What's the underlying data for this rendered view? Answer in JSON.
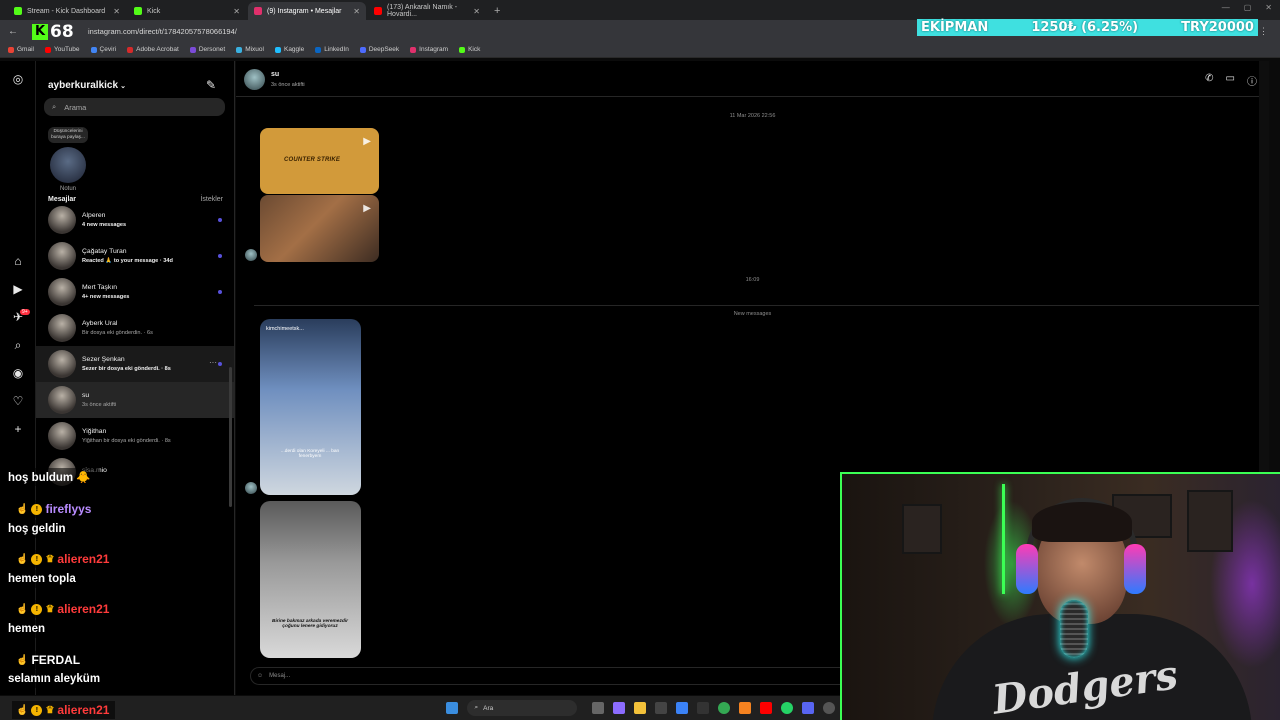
{
  "browser": {
    "tabs": [
      {
        "label": "Stream - Kick Dashboard",
        "color": "#53fc18",
        "active": false
      },
      {
        "label": "Kick",
        "color": "#53fc18",
        "active": false
      },
      {
        "label": "(9) Instagram • Mesajlar",
        "color": "#e1306c",
        "active": true
      },
      {
        "label": "(173) Ankaralı Namık - Hovardi...",
        "color": "#ff0000",
        "active": false
      }
    ],
    "url": "instagram.com/direct/t/17842057578066194/",
    "bookmarks": [
      {
        "label": "Gmail",
        "color": "#ea4335"
      },
      {
        "label": "YouTube",
        "color": "#ff0000"
      },
      {
        "label": "Çeviri",
        "color": "#4285f4"
      },
      {
        "label": "Adobe Acrobat",
        "color": "#d62a2a"
      },
      {
        "label": "Dersonet",
        "color": "#7b4bd8"
      },
      {
        "label": "Mixuol",
        "color": "#3ab0e0"
      },
      {
        "label": "Kaggle",
        "color": "#20beff"
      },
      {
        "label": "LinkedIn",
        "color": "#0a66c2"
      },
      {
        "label": "DeepSeek",
        "color": "#4d6bfe"
      },
      {
        "label": "Instagram",
        "color": "#e1306c"
      },
      {
        "label": "Kick",
        "color": "#53fc18"
      }
    ]
  },
  "kick_overlay": {
    "logo_letter": "K",
    "viewer_count": "68"
  },
  "ticker": {
    "label": "EKİPMAN",
    "progress": "1250₺ (6.25%)",
    "goal": "TRY20000",
    "color": "#3fe0e0"
  },
  "inbox": {
    "username": "ayberkuralkick",
    "search_placeholder": "Arama",
    "note": {
      "bubble": "Düşüncelerini buraya paylaş...",
      "label": "Notun"
    },
    "section_title": "Mesajlar",
    "requests_label": "İstekler",
    "threads": [
      {
        "name": "Alperen",
        "sub": "4 new messages",
        "bold": true,
        "unread": true
      },
      {
        "name": "Çağatay Turan",
        "sub": "Reacted 🙏 to your message · 34d",
        "bold": true,
        "unread": true
      },
      {
        "name": "Mert Taşkın",
        "sub": "4+ new messages",
        "bold": true,
        "unread": true
      },
      {
        "name": "Ayberk Ural",
        "sub": "Bir dosya eki gönderdin. · 6s",
        "bold": false,
        "unread": false
      },
      {
        "name": "Sezer Şenkan",
        "sub": "Sezer bir dosya eki gönderdi. · 8s",
        "bold": true,
        "unread": true
      },
      {
        "name": "su",
        "sub": "3s önce aktifti",
        "bold": false,
        "unread": false
      },
      {
        "name": "Yiğithan",
        "sub": "Yiğithan bir dosya eki gönderdi. · 8s",
        "bold": false,
        "unread": false
      },
      {
        "name": "sisa.mio",
        "sub": "",
        "bold": false,
        "unread": false
      }
    ]
  },
  "chat": {
    "name": "su",
    "status": "3s önce aktifti",
    "date1": "11 Mar 2026 22:56",
    "date2": "16:09",
    "new_messages": "New messages",
    "cs_title": "COUNTER STRIKE",
    "reel1_header": "kimchimeetsk...",
    "reel1_caption": "...derdi olan Koreyeli ... ban fenerbyem",
    "reel2_caption": "Birine bakmaz arkada veremezdir çoğunu lenere gidiyoruz",
    "composer_placeholder": "Mesaj..."
  },
  "stream_chat": [
    {
      "type": "text",
      "text": "hoş buldum 🐥"
    },
    {
      "type": "user",
      "name": "fireflyys",
      "color": "#b98cff"
    },
    {
      "type": "text",
      "text": "hoş geldin"
    },
    {
      "type": "user",
      "name": "alieren21",
      "color": "#ff3b3b"
    },
    {
      "type": "text",
      "text": "hemen topla"
    },
    {
      "type": "user",
      "name": "alieren21",
      "color": "#ff3b3b"
    },
    {
      "type": "text",
      "text": "hemen"
    },
    {
      "type": "user",
      "name": "FERDAL",
      "color": "#ffffff"
    },
    {
      "type": "text",
      "text": "selamın aleyküm"
    },
    {
      "type": "user",
      "name": "alieren21",
      "color": "#ff3b3b"
    }
  ],
  "taskbar": {
    "search": "Ara"
  },
  "webcam": {
    "shirt_text": "Dodgers"
  }
}
